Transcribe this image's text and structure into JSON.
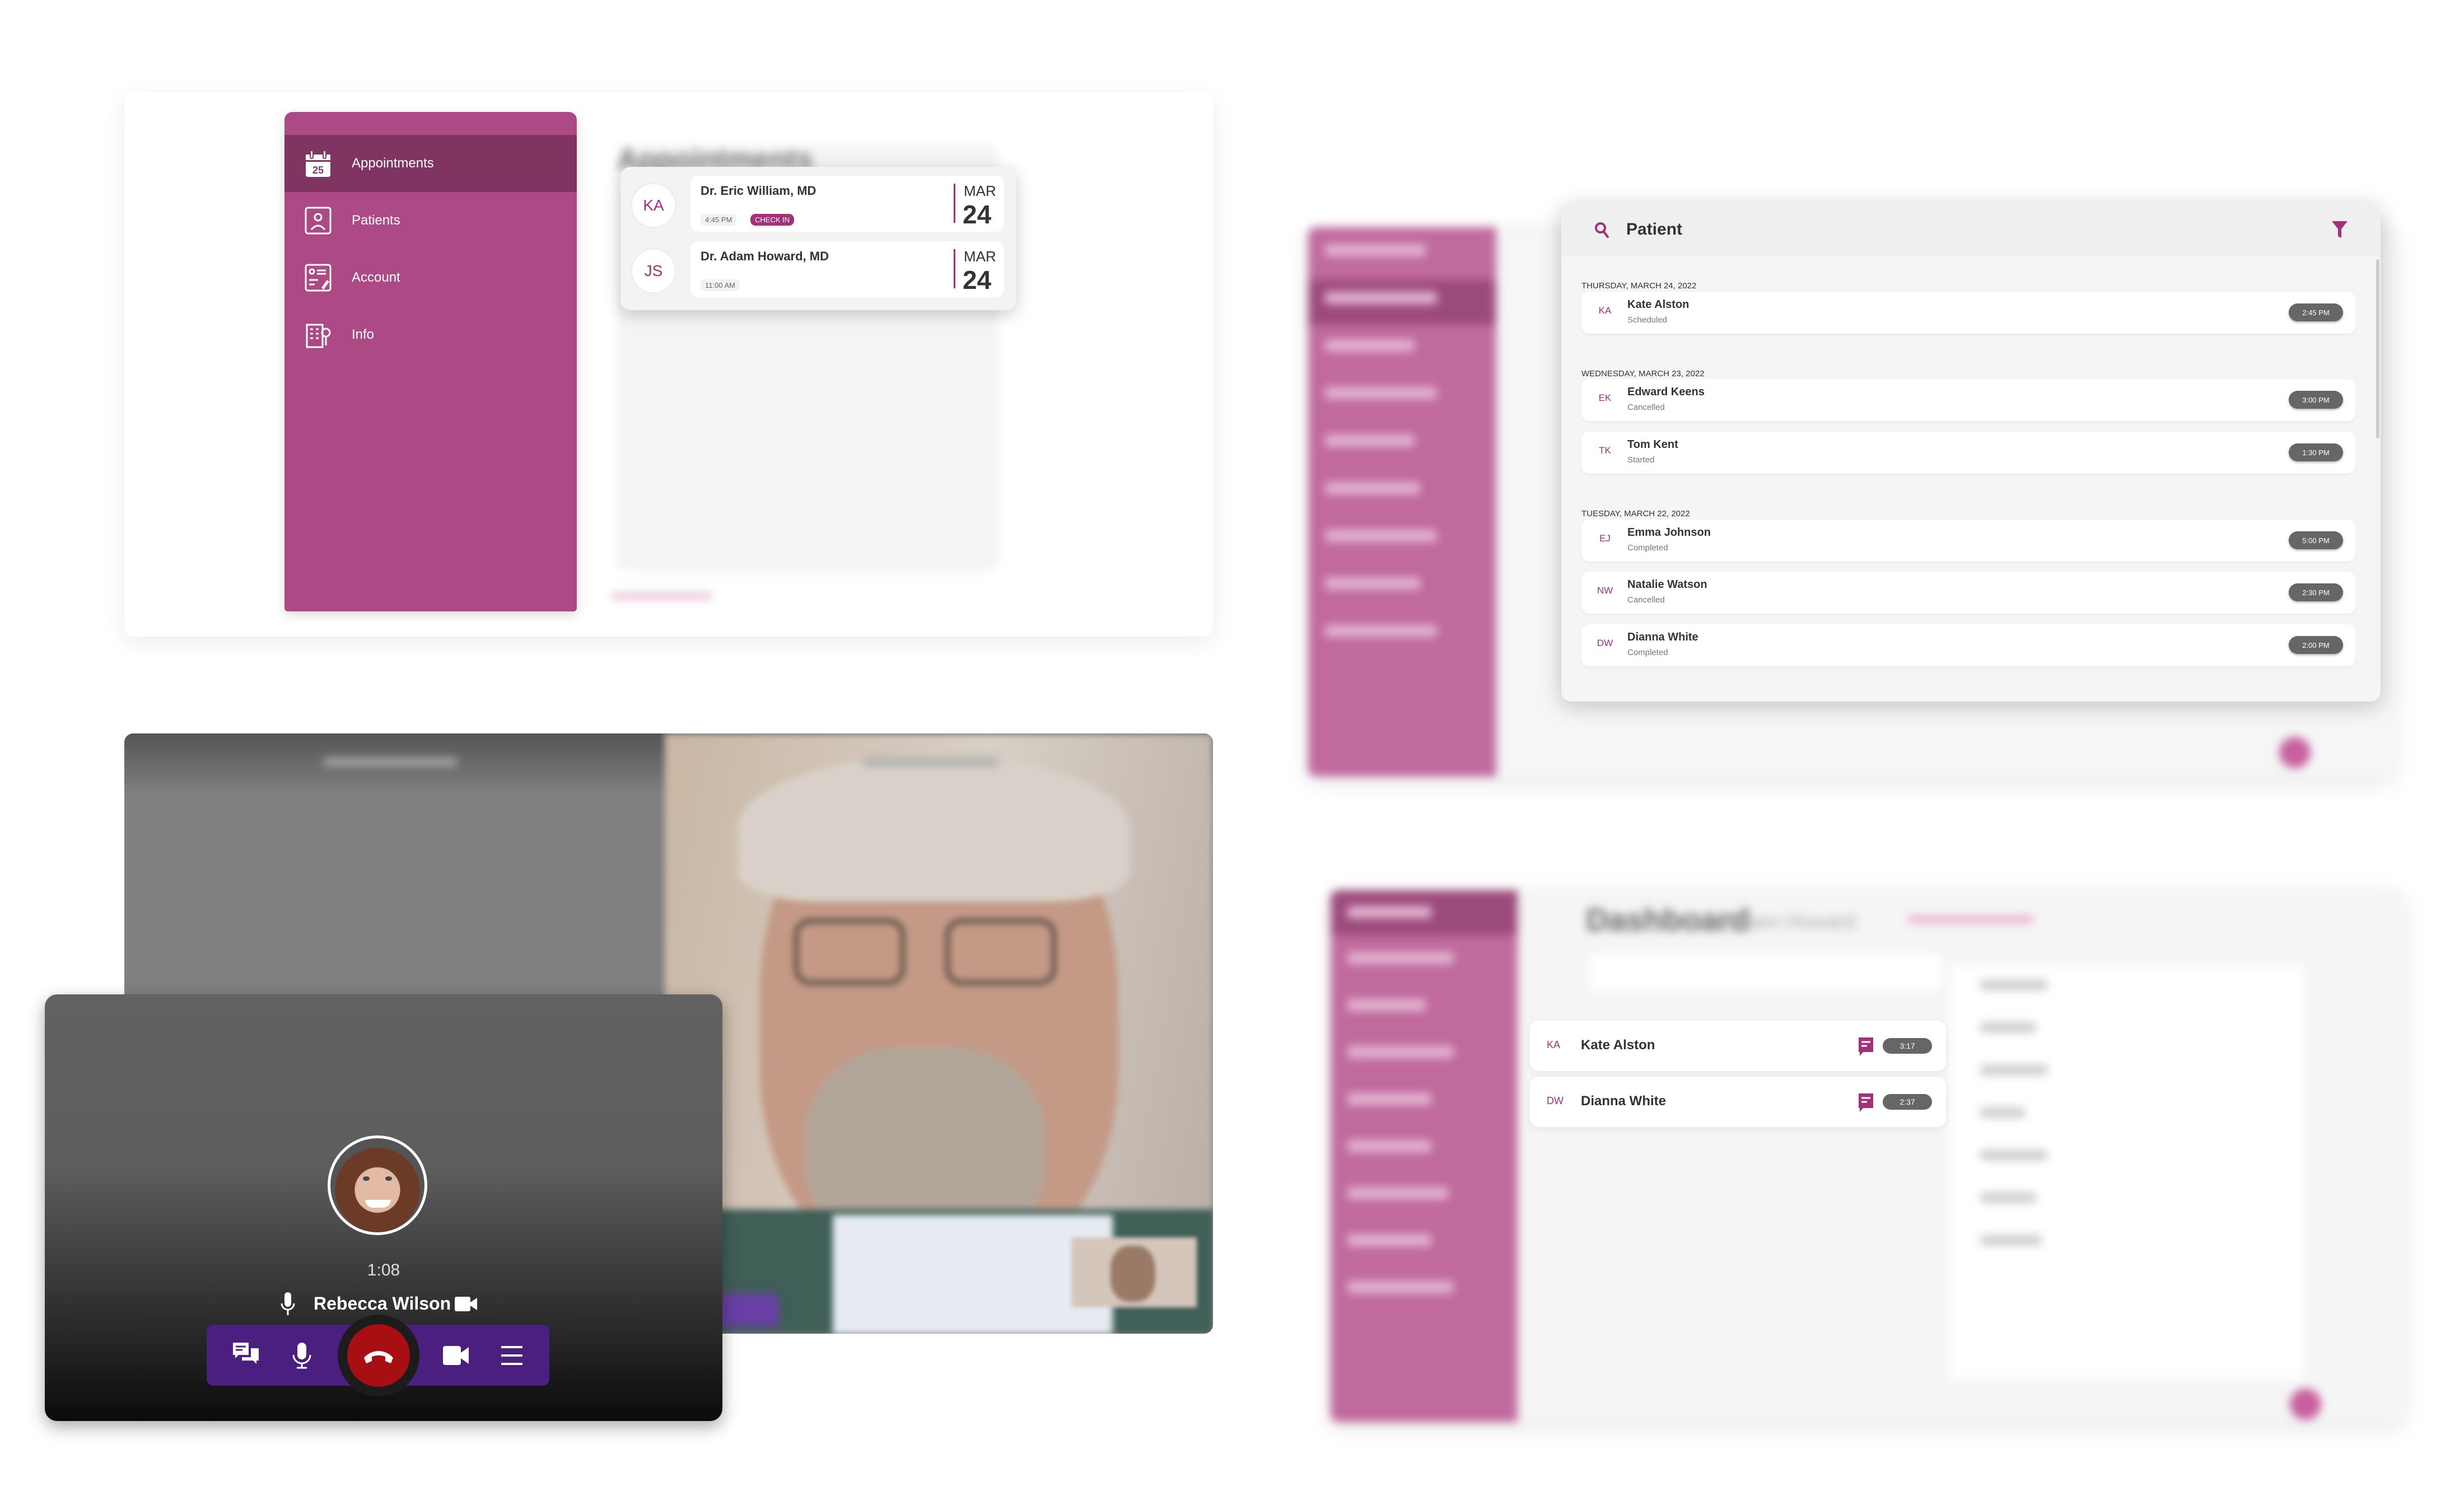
{
  "colors": {
    "accent": "#a5307a",
    "sidebar": "#ad4a86",
    "sidebar_active": "#7f3461",
    "call_bar": "#4a1f80",
    "hangup": "#a80f12",
    "pill": "#666666"
  },
  "sidebar": {
    "items": [
      {
        "label": "Appointments",
        "icon": "calendar-icon",
        "active": true
      },
      {
        "label": "Patients",
        "icon": "patient-card-icon"
      },
      {
        "label": "Account",
        "icon": "account-form-icon"
      },
      {
        "label": "Info",
        "icon": "info-building-icon"
      }
    ],
    "calendar_day": "25"
  },
  "appointments": {
    "background_title": "Appointments",
    "items": [
      {
        "initials": "KA",
        "doctor": "Dr. Eric William, MD",
        "time": "4:45 PM",
        "badge": "CHECK IN",
        "month": "MAR",
        "day": "24"
      },
      {
        "initials": "JS",
        "doctor": "Dr. Adam Howard, MD",
        "time": "11:00 AM",
        "month": "MAR",
        "day": "24"
      }
    ]
  },
  "patient_search": {
    "title": "Patient",
    "groups": [
      {
        "date": "THURSDAY, MARCH 24, 2022",
        "rows": [
          {
            "initials": "KA",
            "name": "Kate Alston",
            "status": "Scheduled",
            "time": "2:45 PM"
          }
        ]
      },
      {
        "date": "WEDNESDAY, MARCH 23, 2022",
        "rows": [
          {
            "initials": "EK",
            "name": "Edward Keens",
            "status": "Cancelled",
            "time": "3:00 PM"
          },
          {
            "initials": "TK",
            "name": "Tom Kent",
            "status": "Started",
            "time": "1:30 PM"
          }
        ]
      },
      {
        "date": "TUESDAY, MARCH 22, 2022",
        "rows": [
          {
            "initials": "EJ",
            "name": "Emma Johnson",
            "status": "Completed",
            "time": "5:00 PM"
          },
          {
            "initials": "NW",
            "name": "Natalie Watson",
            "status": "Cancelled",
            "time": "2:30 PM"
          },
          {
            "initials": "DW",
            "name": "Dianna White",
            "status": "Completed",
            "time": "2:00 PM"
          }
        ]
      }
    ]
  },
  "call": {
    "timer": "1:08",
    "name": "Rebecca Wilson"
  },
  "dashboard": {
    "title": "Dashboard",
    "subtitle": "Adam Howard",
    "waiting": [
      {
        "initials": "KA",
        "name": "Kate Alston",
        "wait": "3:17"
      },
      {
        "initials": "DW",
        "name": "Dianna White",
        "wait": "2:37"
      }
    ]
  }
}
